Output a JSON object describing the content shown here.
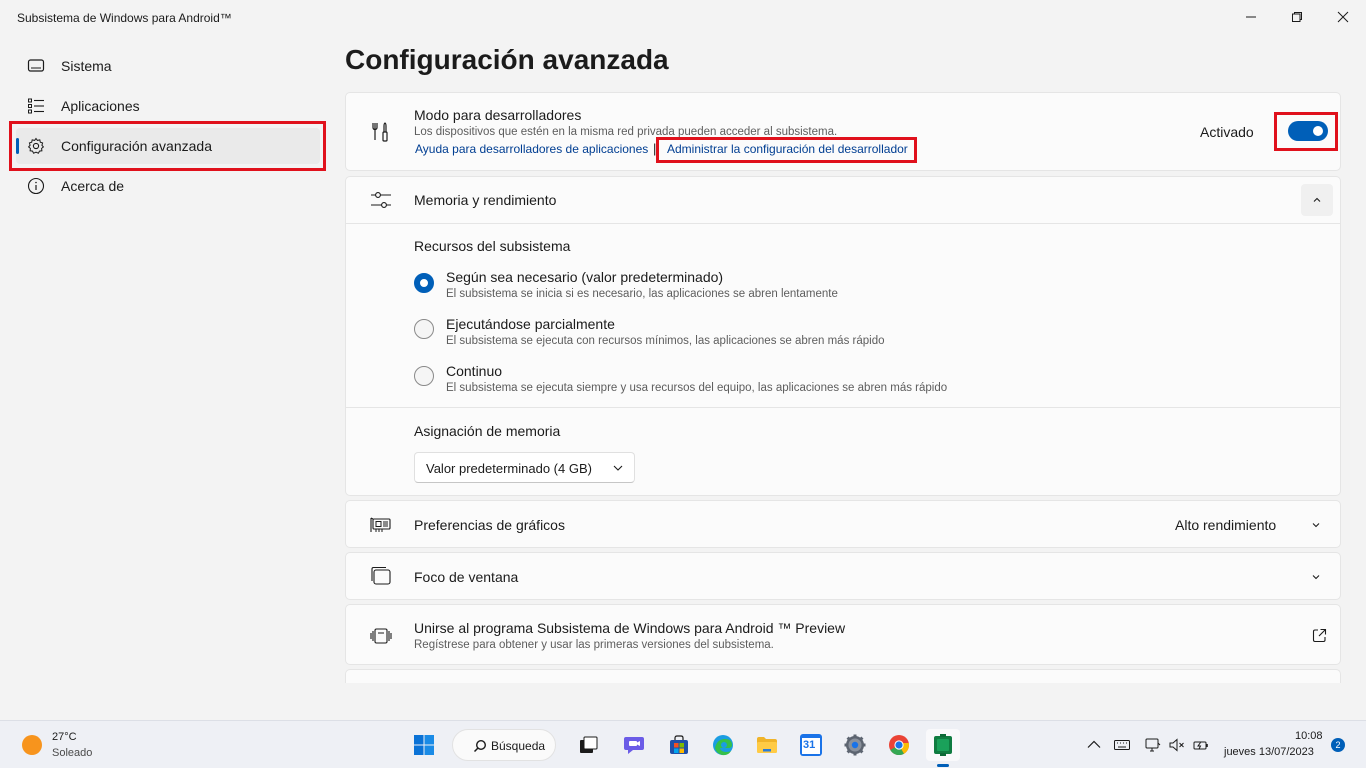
{
  "window": {
    "title": "Subsistema de Windows para Android™"
  },
  "sidebar": {
    "items": [
      {
        "label": "Sistema",
        "icon": "monitor-icon"
      },
      {
        "label": "Aplicaciones",
        "icon": "list-icon"
      },
      {
        "label": "Configuración avanzada",
        "icon": "gear-icon",
        "active": true
      },
      {
        "label": "Acerca de",
        "icon": "info-icon"
      }
    ]
  },
  "main": {
    "title": "Configuración avanzada",
    "developer": {
      "title": "Modo para desarrolladores",
      "description": "Los dispositivos que estén en la misma red privada pueden acceder al subsistema.",
      "link1": "Ayuda para desarrolladores de aplicaciones",
      "separator": "|",
      "link2": "Administrar la configuración del desarrollador",
      "status": "Activado",
      "toggle_on": true
    },
    "memory": {
      "title": "Memoria y rendimiento",
      "resources_heading": "Recursos del subsistema",
      "options": [
        {
          "label": "Según sea necesario (valor predeterminado)",
          "desc": "El subsistema se inicia si es necesario, las aplicaciones se abren lentamente",
          "checked": true
        },
        {
          "label": "Ejecutándose parcialmente",
          "desc": "El subsistema se ejecuta con recursos mínimos, las aplicaciones se abren más rápido",
          "checked": false
        },
        {
          "label": "Continuo",
          "desc": "El subsistema se ejecuta siempre y usa recursos del equipo, las aplicaciones se abren más rápido",
          "checked": false
        }
      ],
      "allocation_heading": "Asignación de memoria",
      "allocation_value": "Valor predeterminado (4 GB)"
    },
    "graphics": {
      "title": "Preferencias de gráficos",
      "value": "Alto rendimiento"
    },
    "focus": {
      "title": "Foco de ventana"
    },
    "preview": {
      "title": "Unirse al programa Subsistema de Windows para Android ™ Preview",
      "description": "Regístrese para obtener y usar las primeras versiones del subsistema."
    }
  },
  "taskbar": {
    "weather_temp": "27°C",
    "weather_desc": "Soleado",
    "search_label": "Búsqueda",
    "calendar_day": "31",
    "time": "10:08",
    "date": "jueves 13/07/2023",
    "notification_count": "2"
  },
  "colors": {
    "accent": "#005fb8",
    "highlight": "#e0111c"
  }
}
